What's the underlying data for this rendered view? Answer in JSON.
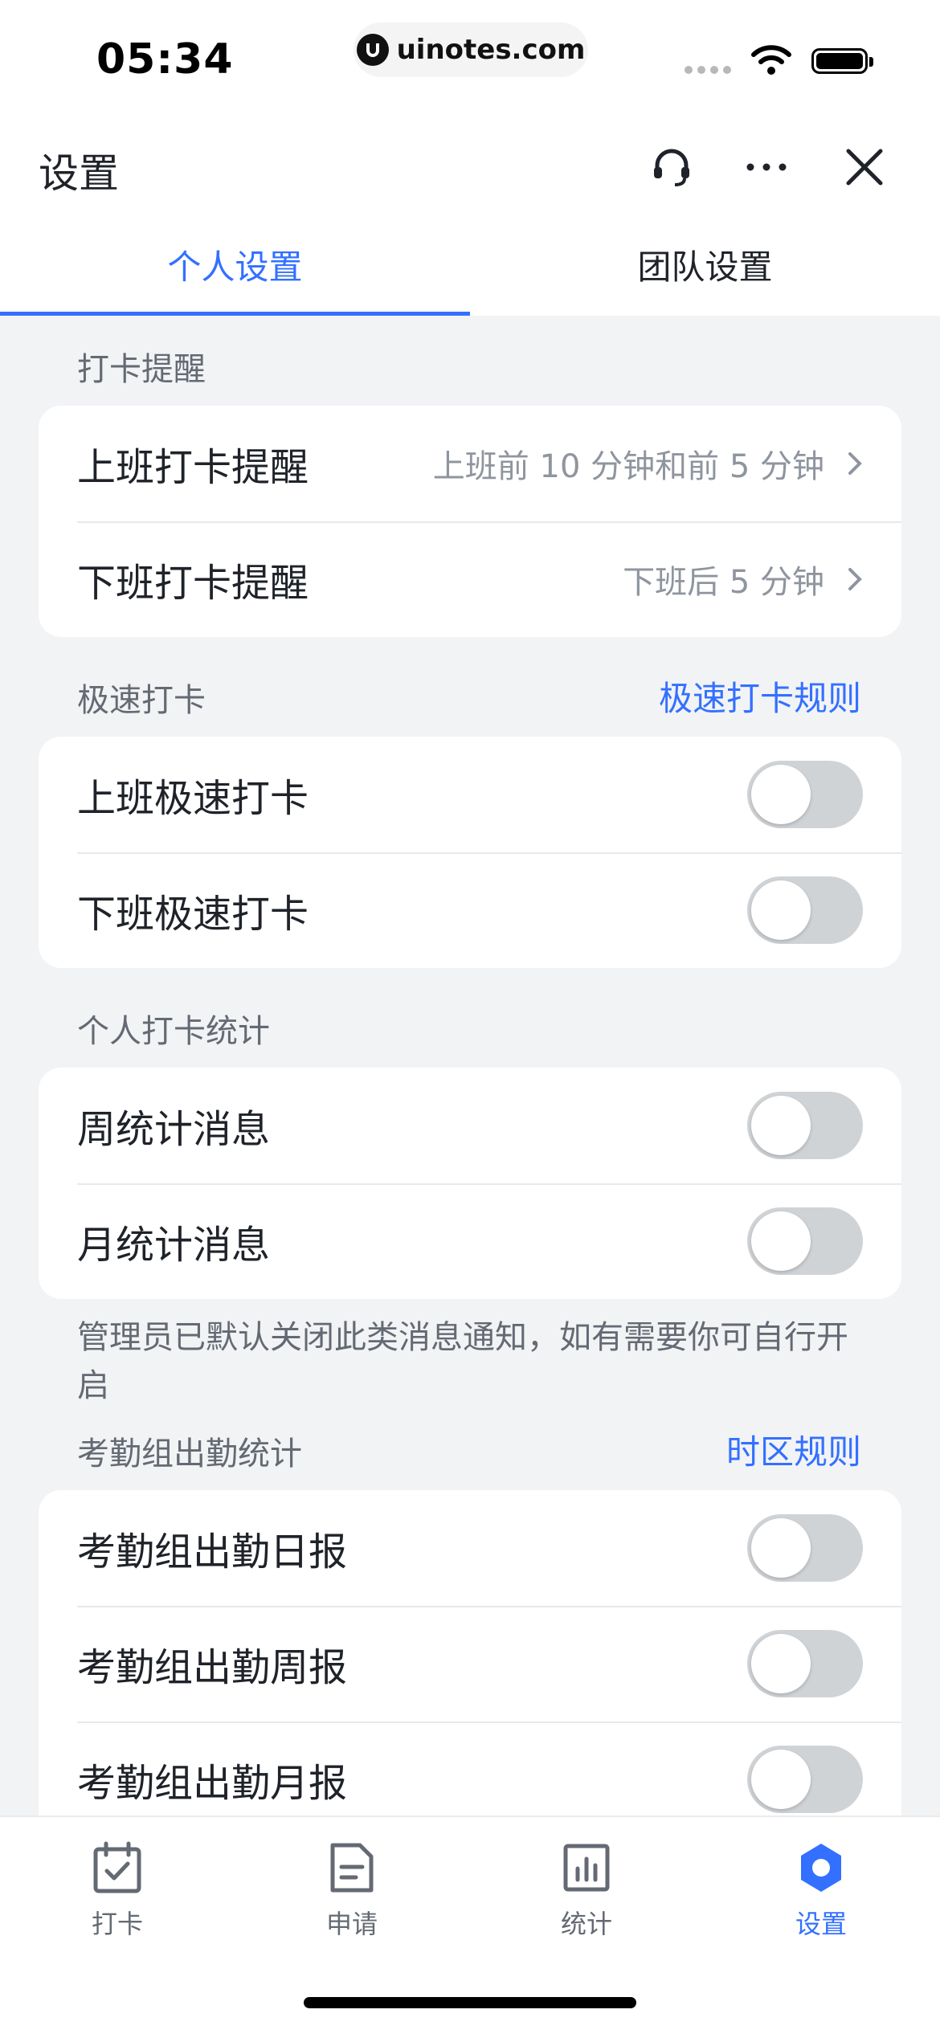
{
  "status_bar": {
    "time": "05:34",
    "url": "uinotes.com"
  },
  "header": {
    "title": "设置"
  },
  "tabs": [
    {
      "label": "个人设置",
      "active": true
    },
    {
      "label": "团队设置",
      "active": false
    }
  ],
  "sections": {
    "reminder": {
      "title": "打卡提醒",
      "rows": [
        {
          "label": "上班打卡提醒",
          "value": "上班前 10 分钟和前 5 分钟"
        },
        {
          "label": "下班打卡提醒",
          "value": "下班后 5 分钟"
        }
      ]
    },
    "quick": {
      "title": "极速打卡",
      "link": "极速打卡规则",
      "rows": [
        {
          "label": "上班极速打卡",
          "on": false
        },
        {
          "label": "下班极速打卡",
          "on": false
        }
      ]
    },
    "personal_stats": {
      "title": "个人打卡统计",
      "rows": [
        {
          "label": "周统计消息",
          "on": false
        },
        {
          "label": "月统计消息",
          "on": false
        }
      ],
      "note": "管理员已默认关闭此类消息通知，如有需要你可自行开启"
    },
    "group_stats": {
      "title": "考勤组出勤统计",
      "link": "时区规则",
      "rows": [
        {
          "label": "考勤组出勤日报",
          "on": false
        },
        {
          "label": "考勤组出勤周报",
          "on": false
        },
        {
          "label": "考勤组出勤月报",
          "on": false
        }
      ]
    }
  },
  "bottom_nav": [
    {
      "label": "打卡",
      "icon": "calendar-check-icon",
      "active": false
    },
    {
      "label": "申请",
      "icon": "document-icon",
      "active": false
    },
    {
      "label": "统计",
      "icon": "bar-chart-icon",
      "active": false
    },
    {
      "label": "设置",
      "icon": "gear-icon",
      "active": true
    }
  ],
  "colors": {
    "accent": "#3370ff",
    "toggle_off": "#d0d3d6",
    "background": "#f2f3f5"
  }
}
